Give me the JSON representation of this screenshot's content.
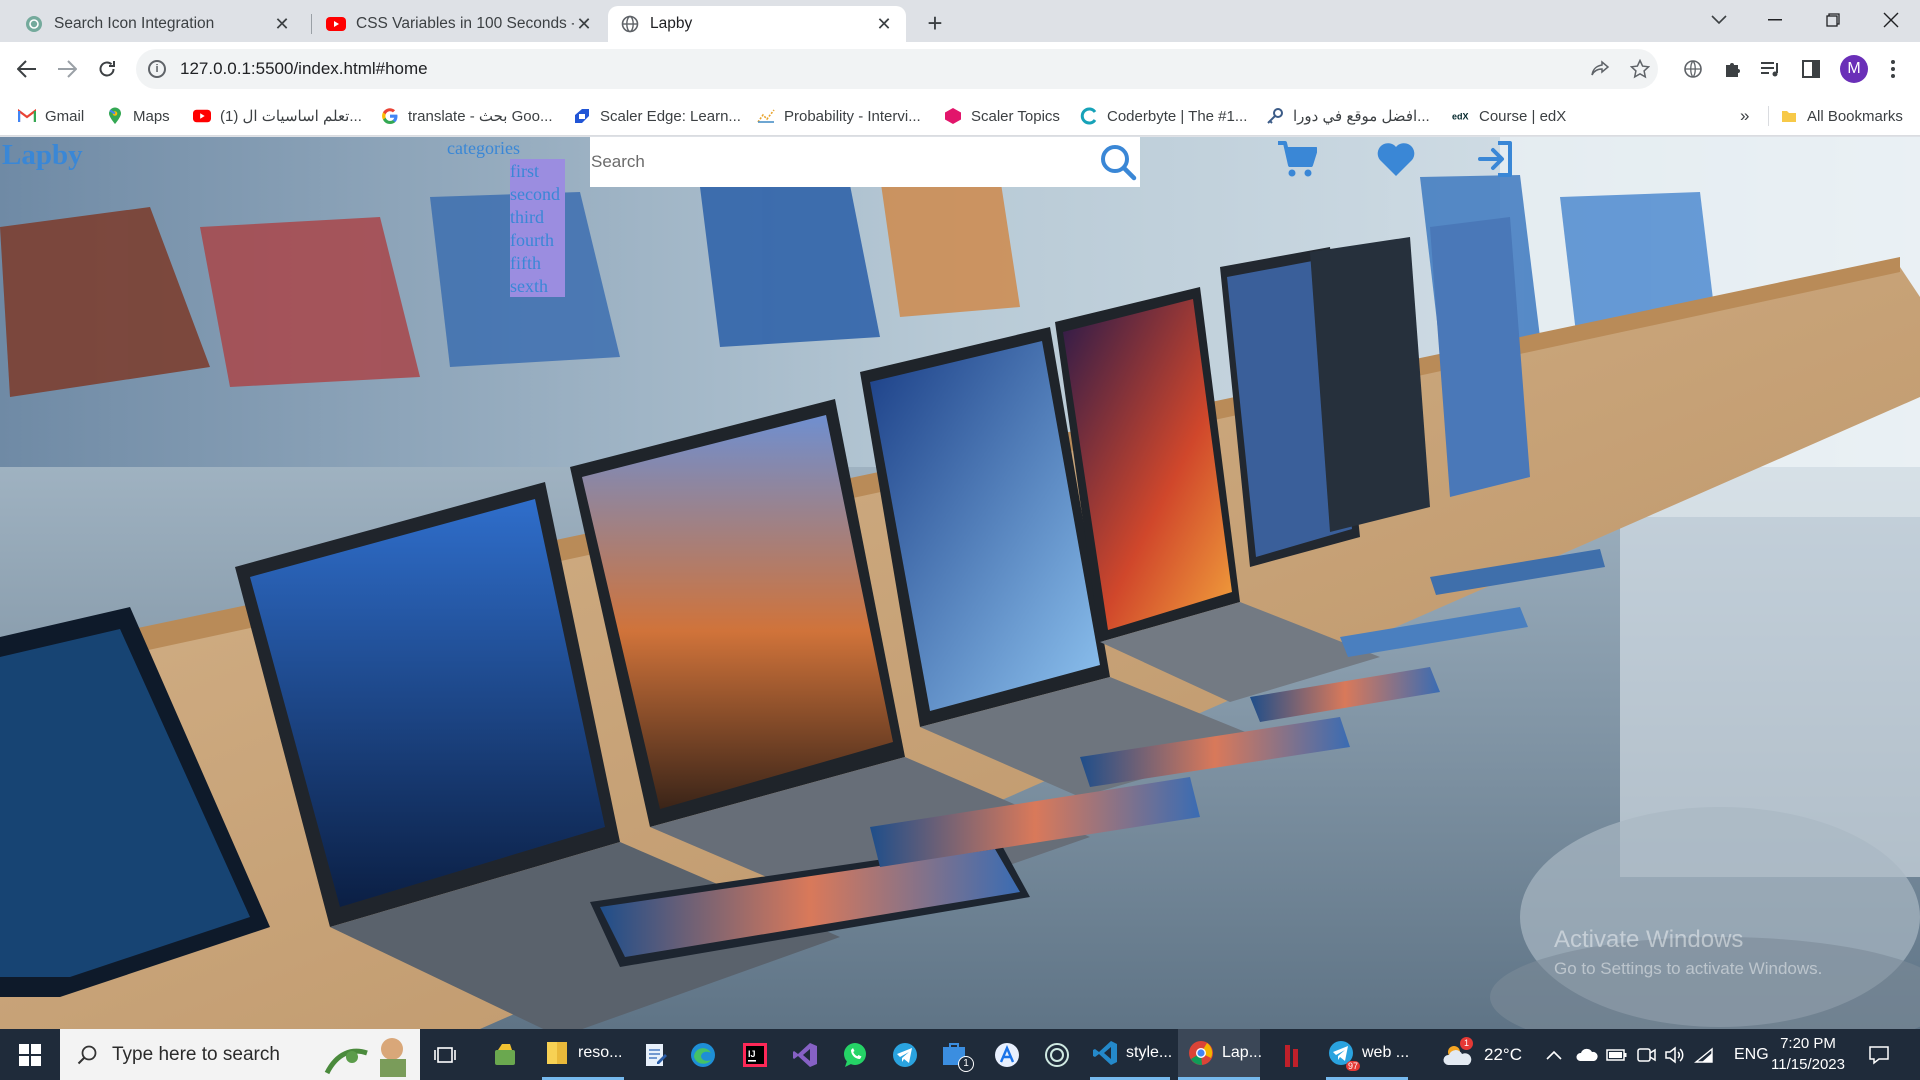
{
  "browser": {
    "tabs": [
      {
        "title": "Search Icon Integration",
        "favicon": "chatgpt-icon"
      },
      {
        "title": "CSS Variables in 100 Seconds - Y",
        "favicon": "youtube-icon"
      },
      {
        "title": "Lapby",
        "favicon": "globe-icon"
      }
    ],
    "url": "127.0.0.1:5500/index.html#home",
    "profile_initial": "M",
    "bookmarks": [
      {
        "label": "Gmail",
        "icon": "gmail-icon"
      },
      {
        "label": "Maps",
        "icon": "maps-icon"
      },
      {
        "label": "(1) تعلم اساسيات ال...",
        "icon": "youtube-icon"
      },
      {
        "label": "translate - بحث Goo...",
        "icon": "google-icon"
      },
      {
        "label": "Scaler Edge: Learn...",
        "icon": "scaler-icon"
      },
      {
        "label": "Probability - Intervi...",
        "icon": "chart-icon"
      },
      {
        "label": "Scaler Topics",
        "icon": "scaler-topics-icon"
      },
      {
        "label": "Coderbyte | The #1...",
        "icon": "coderbyte-icon"
      },
      {
        "label": "افضل موقع في دورا...",
        "icon": "key-icon"
      },
      {
        "label": "Course | edX",
        "icon": "edx-icon"
      }
    ],
    "more_bookmarks": "»",
    "all_bookmarks": "All Bookmarks"
  },
  "page": {
    "brand": "Lapby",
    "categories_label": "categories",
    "categories": [
      "first",
      "second",
      "third",
      "fourth",
      "fifth",
      "sexth"
    ],
    "search_placeholder": "Search",
    "nav_icons": [
      "cart-icon",
      "heart-icon",
      "login-icon"
    ],
    "accent_color": "#3a87d6",
    "watermark_title": "Activate Windows",
    "watermark_sub": "Go to Settings to activate Windows."
  },
  "taskbar": {
    "search_placeholder": "Type here to search",
    "apps": [
      {
        "name": "task-view",
        "label": ""
      },
      {
        "name": "app-folder-tools",
        "label": ""
      },
      {
        "name": "file-explorer",
        "label": "reso..."
      },
      {
        "name": "notepad",
        "label": ""
      },
      {
        "name": "edge",
        "label": ""
      },
      {
        "name": "intellij",
        "label": ""
      },
      {
        "name": "visual-studio",
        "label": ""
      },
      {
        "name": "whatsapp",
        "label": ""
      },
      {
        "name": "telegram",
        "label": ""
      },
      {
        "name": "store",
        "label": ""
      },
      {
        "name": "app-a",
        "label": ""
      },
      {
        "name": "chatgpt",
        "label": ""
      },
      {
        "name": "vscode",
        "label": "style..."
      },
      {
        "name": "chrome",
        "label": "Lap..."
      },
      {
        "name": "app-red",
        "label": ""
      },
      {
        "name": "telegram-web",
        "label": "web ..."
      }
    ],
    "store_badge": "1",
    "telegram_badge": "97",
    "weather_badge": "1",
    "weather": "22°C",
    "language": "ENG",
    "time": "7:20 PM",
    "date": "11/15/2023"
  }
}
